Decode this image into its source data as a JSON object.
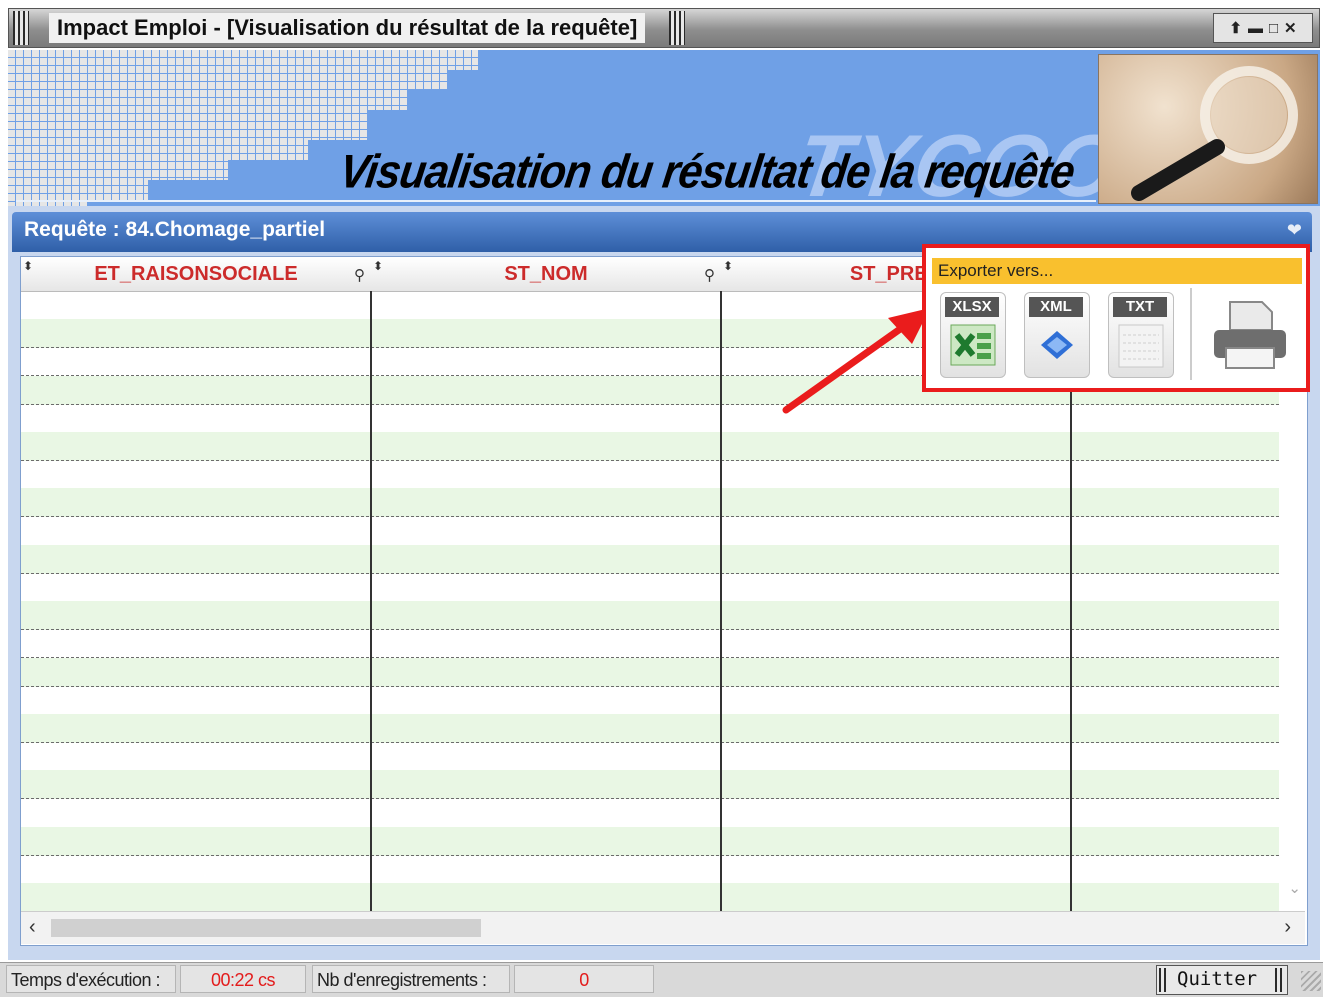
{
  "window": {
    "title": "Impact Emploi - [Visualisation du résultat de la requête]",
    "controls": "⬆▬▫✕"
  },
  "banner": {
    "brand": "TYCOON",
    "title": "Visualisation du résultat de la requête"
  },
  "query": {
    "label": "Requête : 84.Chomage_partiel"
  },
  "grid": {
    "columns": [
      "ET_RAISONSOCIALE",
      "ST_NOM",
      "ST_PREN"
    ],
    "row_count": 22
  },
  "export": {
    "label": "Exporter vers...",
    "formats": [
      "XLSX",
      "XML",
      "TXT"
    ]
  },
  "status": {
    "exec_time_label": "Temps d'exécution :",
    "exec_time_value": "00:22 cs",
    "records_label": "Nb d'enregistrements :",
    "records_value": "0"
  },
  "buttons": {
    "quit": "Quitter"
  },
  "colors": {
    "banner_blue": "#6fa0e6",
    "header_text": "#cc2b2b",
    "highlight_red": "#ea1c1c",
    "export_bar": "#f9c02e"
  }
}
